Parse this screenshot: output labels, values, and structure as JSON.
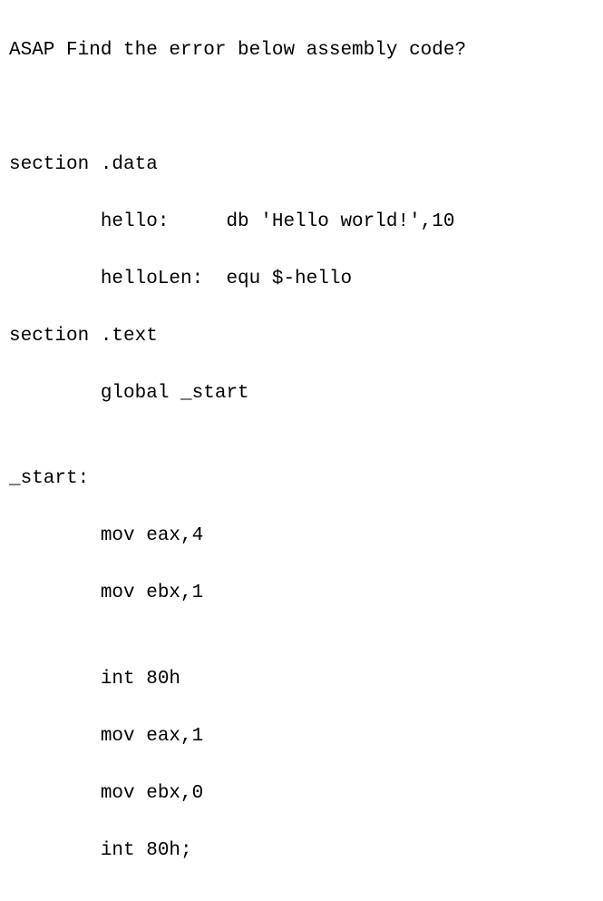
{
  "title": "ASAP Find the error below assembly code?",
  "code": {
    "l1": "section .data",
    "l2": "        hello:     db 'Hello world!',10",
    "l3": "        helloLen:  equ $-hello",
    "l4": "section .text",
    "l5": "        global _start",
    "l6": "",
    "l7": "_start:",
    "l8": "        mov eax,4",
    "l9": "        mov ebx,1",
    "l10": "",
    "l11": "        int 80h",
    "l12": "        mov eax,1",
    "l13": "        mov ebx,0",
    "l14": "        int 80h;"
  }
}
